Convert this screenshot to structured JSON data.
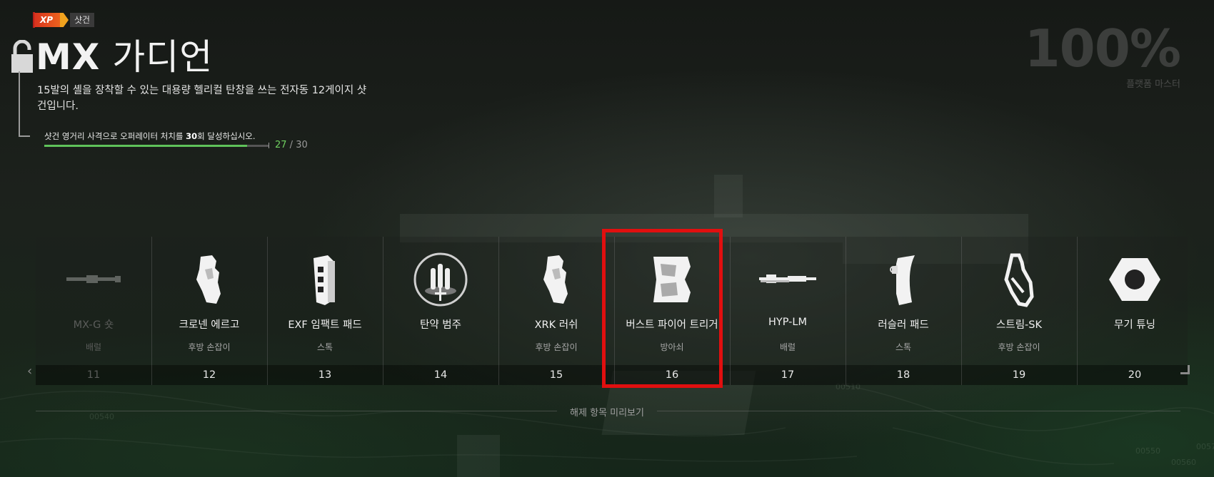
{
  "header": {
    "xp_badge_text": "XP",
    "weapon_class": "샷건",
    "weapon_name_bold": "MX",
    "weapon_name_rest": " 가디언",
    "description": "15발의 셸을 장착할 수 있는 대용량 헬리컬 탄창을 쓰는 전자동 12게이지 샷건입니다.",
    "challenge_pre": "샷건 영거리 사격으로 오퍼레이터 처치를 ",
    "challenge_count": "30",
    "challenge_post": "회 달성하십시오.",
    "progress_current": "27",
    "progress_sep": " / ",
    "progress_total": "30",
    "progress_fraction": 0.9
  },
  "mastery": {
    "percent": "100%",
    "label": "플랫폼 마스터"
  },
  "unlocks": [
    {
      "name": "MX-G 숏",
      "category": "배럴",
      "level": "11",
      "icon": "barrel-short-icon",
      "dim": true
    },
    {
      "name": "크로넨 에르고",
      "category": "후방 손잡이",
      "level": "12",
      "icon": "rear-grip-icon",
      "dim": false
    },
    {
      "name": "EXF 임팩트 패드",
      "category": "스톡",
      "level": "13",
      "icon": "stock-pad-icon",
      "dim": false
    },
    {
      "name": "탄약 범주",
      "category": "",
      "level": "14",
      "icon": "ammo-icon",
      "dim": false
    },
    {
      "name": "XRK 러쉬",
      "category": "후방 손잡이",
      "level": "15",
      "icon": "rear-grip-icon",
      "dim": false
    },
    {
      "name": "버스트 파이어 트리거",
      "category": "방아쇠",
      "level": "16",
      "icon": "trigger-icon",
      "dim": false
    },
    {
      "name": "HYP-LM",
      "category": "배럴",
      "level": "17",
      "icon": "barrel-long-icon",
      "dim": false
    },
    {
      "name": "러슬러 패드",
      "category": "스톡",
      "level": "18",
      "icon": "stock-pad-curved-icon",
      "dim": false
    },
    {
      "name": "스트림-SK",
      "category": "후방 손잡이",
      "level": "19",
      "icon": "skeleton-grip-icon",
      "dim": false
    },
    {
      "name": "무기 튜닝",
      "category": "",
      "level": "20",
      "icon": "hex-nut-icon",
      "dim": false
    }
  ],
  "preview_label": "해제 항목 미리보기",
  "colors": {
    "xp_red": "#d8321e",
    "progress_green": "#5fc25a",
    "highlight_red": "#e10f0f"
  }
}
